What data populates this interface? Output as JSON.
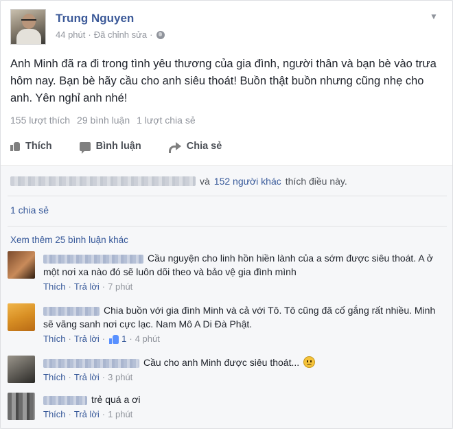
{
  "post": {
    "author": "Trung Nguyen",
    "time": "44 phút",
    "separator": "·",
    "edited": "Đã chỉnh sửa",
    "text": "Anh Minh đã ra đi trong tình yêu thương của gia đình, người thân và bạn bè vào trưa hôm nay. Bạn bè hãy cầu cho anh siêu thoát! Buồn thật buồn nhưng cũng nhẹ cho anh. Yên nghỉ anh nhé!",
    "counts": {
      "likes": "155 lượt thích",
      "comments": "29 bình luận",
      "shares": "1 lượt chia sẻ"
    },
    "icons": {
      "privacy": "globe-icon",
      "menu": "chevron-down-icon"
    }
  },
  "actions": {
    "like": "Thích",
    "comment": "Bình luận",
    "share": "Chia sẻ"
  },
  "feedback": {
    "likers_prefix": "và",
    "likers_link": "152 người khác",
    "likers_suffix": "thích điều này.",
    "shares_link": "1 chia sẻ",
    "more_comments": "Xem thêm 25 bình luận khác"
  },
  "comments": [
    {
      "text": "Cầu nguyện cho linh hồn hiền lành của a sớm được siêu thoát. A ở một nơi xa nào đó sẽ luôn dõi theo và bảo vệ gia đình mình",
      "like": "Thích",
      "reply": "Trả lời",
      "time": "7 phút",
      "likes": ""
    },
    {
      "text": "Chia buồn với gia đình Minh và cả với Tô. Tô cũng đã cố gắng rất nhiều. Minh sẽ vãng sanh nơi cực lạc. Nam Mô A Di Đà Phật.",
      "like": "Thích",
      "reply": "Trả lời",
      "time": "4 phút",
      "likes": "1"
    },
    {
      "text": "Cầu cho anh Minh được siêu thoát...",
      "like": "Thích",
      "reply": "Trả lời",
      "time": "3 phút",
      "likes": ""
    },
    {
      "text": "trẻ quá a ơi",
      "like": "Thích",
      "reply": "Trả lời",
      "time": "1 phút",
      "likes": ""
    }
  ],
  "colors": {
    "link": "#365899",
    "author": "#3b5998",
    "muted": "#90949c"
  }
}
